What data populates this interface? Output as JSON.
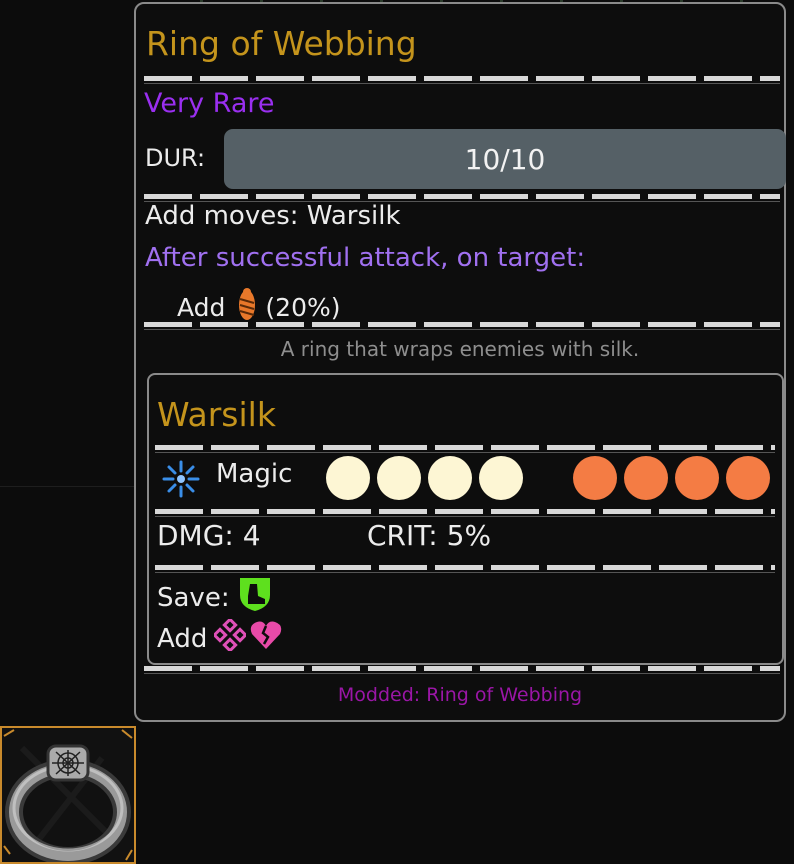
{
  "item": {
    "title": "Ring of Webbing",
    "rarity": "Very Rare",
    "durability_label": "DUR:",
    "durability_value": "10/10",
    "durability_fraction": 1.0,
    "add_moves": "Add moves: Warsilk",
    "trigger": "After successful attack, on target:",
    "effect_prefix": "Add",
    "effect_icon": "cocoon-icon",
    "effect_chance": "(20%)",
    "description": "A ring that wraps enemies with silk.",
    "footer": "Modded: Ring of Webbing",
    "slot_icon": "spider-web-ring-icon"
  },
  "skill": {
    "title": "Warsilk",
    "type_icon": "magic-burst-icon",
    "type_label": "Magic",
    "usable_positions": 4,
    "target_positions": 4,
    "dmg": "DMG: 4",
    "crit": "CRIT: 5%",
    "save_label": "Save:",
    "save_icon": "shield-boot-icon",
    "add_label": "Add",
    "add_icons": [
      "diamond-pattern-icon",
      "broken-heart-icon"
    ]
  },
  "colors": {
    "title": "#c4941c",
    "rarity": "#9a2ff0",
    "trigger": "#a070f0",
    "footer": "#9a16a6",
    "self_pip": "#fdf6d4",
    "target_pip": "#f47c44",
    "bar": "#556066"
  }
}
